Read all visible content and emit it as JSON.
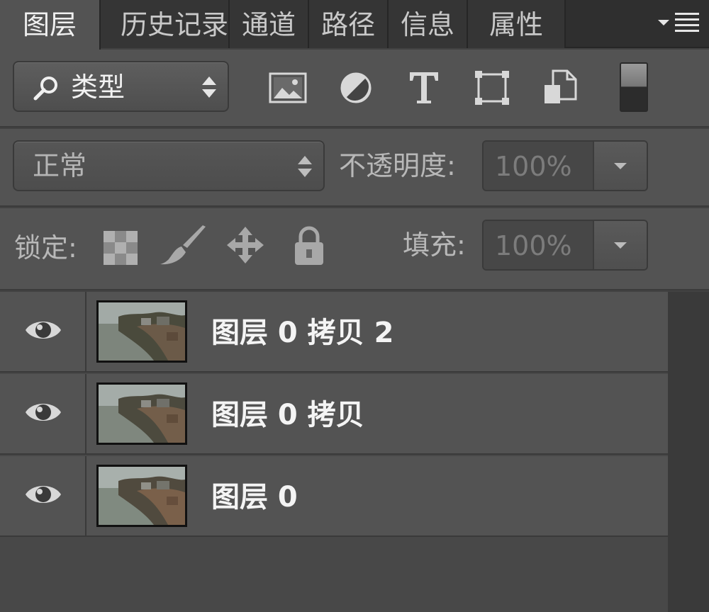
{
  "tabs": [
    {
      "label": "图层",
      "active": true
    },
    {
      "label": "历史记录",
      "active": false
    },
    {
      "label": "通道",
      "active": false
    },
    {
      "label": "路径",
      "active": false
    },
    {
      "label": "信息",
      "active": false
    },
    {
      "label": "属性",
      "active": false
    }
  ],
  "filter": {
    "type_label": "类型",
    "icons": [
      "image-filter-icon",
      "adjustment-filter-icon",
      "type-filter-icon",
      "shape-filter-icon",
      "smart-object-filter-icon",
      "filter-toggle-icon"
    ]
  },
  "blend": {
    "mode": "正常",
    "opacity_label": "不透明度:",
    "opacity_value": "100%"
  },
  "lock": {
    "label": "锁定:",
    "icons": [
      "lock-transparent-icon",
      "lock-brush-icon",
      "lock-move-icon",
      "lock-all-icon"
    ],
    "fill_label": "填充:",
    "fill_value": "100%"
  },
  "layers": [
    {
      "name": "图层 0 拷贝 2",
      "visible": true
    },
    {
      "name": "图层 0 拷贝",
      "visible": true
    },
    {
      "name": "图层 0",
      "visible": true
    }
  ],
  "colors": {
    "panel": "#535353",
    "tab_bar": "#2f2f2f",
    "text": "#f4f4f4"
  }
}
